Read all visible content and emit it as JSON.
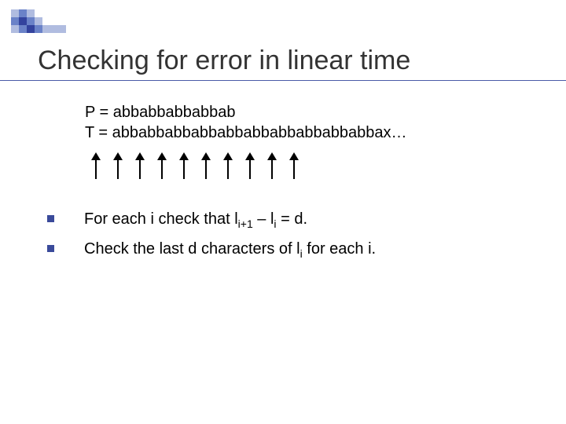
{
  "title": "Checking for error in linear time",
  "strings": {
    "P_label": "P = ",
    "P_value": "abbabbabbabbab",
    "T_label": "T = ",
    "T_value": "abbabbabbabbabbabbabbabbabbabbax…"
  },
  "arrow_count": 10,
  "bullets": [
    {
      "parts": [
        {
          "t": "For each i check that l"
        },
        {
          "t": "i+1",
          "sub": true
        },
        {
          "t": " – l"
        },
        {
          "t": "i",
          "sub": true
        },
        {
          "t": " = d."
        }
      ]
    },
    {
      "parts": [
        {
          "t": "Check the last d characters of l"
        },
        {
          "t": "i",
          "sub": true
        },
        {
          "t": " for each i."
        }
      ]
    }
  ],
  "deco_pattern": [
    [
      "c0",
      "c1",
      "c0",
      "ce",
      "ce",
      "ce",
      "ce"
    ],
    [
      "c1",
      "c2",
      "c1",
      "c0",
      "ce",
      "ce",
      "ce"
    ],
    [
      "c0",
      "c1",
      "c2",
      "c1",
      "c0",
      "c0",
      "c0"
    ]
  ]
}
